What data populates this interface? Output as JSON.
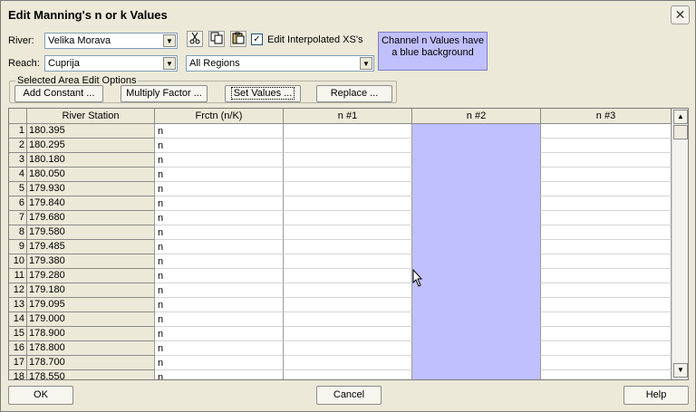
{
  "window": {
    "title": "Edit Manning's n or k Values",
    "close_glyph": "✕"
  },
  "river": {
    "label": "River:",
    "value": "Velika Morava"
  },
  "reach": {
    "label": "Reach:",
    "value": "Cuprija"
  },
  "regions": {
    "value": "All Regions"
  },
  "toolbar": {
    "cut_icon": "scissors-icon",
    "copy_icon": "copy-icon",
    "paste_icon": "paste-icon"
  },
  "interp": {
    "checked": true,
    "check_glyph": "✓",
    "label": "Edit Interpolated XS's"
  },
  "note": {
    "text": "Channel n Values have a blue background",
    "color": "#c0c0ff"
  },
  "selected_area": {
    "legend": "Selected Area Edit Options",
    "add_constant": "Add Constant ...",
    "multiply_factor": "Multiply Factor ...",
    "set_values": "Set Values ...",
    "replace": "Replace ..."
  },
  "table": {
    "headers": [
      "River Station",
      "Frctn (n/K)",
      "n #1",
      "n #2",
      "n #3"
    ],
    "rows": [
      {
        "num": "1",
        "station": "180.395",
        "frctn": "n"
      },
      {
        "num": "2",
        "station": "180.295",
        "frctn": "n"
      },
      {
        "num": "3",
        "station": "180.180",
        "frctn": "n"
      },
      {
        "num": "4",
        "station": "180.050",
        "frctn": "n"
      },
      {
        "num": "5",
        "station": "179.930",
        "frctn": "n"
      },
      {
        "num": "6",
        "station": "179.840",
        "frctn": "n"
      },
      {
        "num": "7",
        "station": "179.680",
        "frctn": "n"
      },
      {
        "num": "8",
        "station": "179.580",
        "frctn": "n"
      },
      {
        "num": "9",
        "station": "179.485",
        "frctn": "n"
      },
      {
        "num": "10",
        "station": "179.380",
        "frctn": "n"
      },
      {
        "num": "11",
        "station": "179.280",
        "frctn": "n"
      },
      {
        "num": "12",
        "station": "179.180",
        "frctn": "n"
      },
      {
        "num": "13",
        "station": "179.095",
        "frctn": "n"
      },
      {
        "num": "14",
        "station": "179.000",
        "frctn": "n"
      },
      {
        "num": "15",
        "station": "178.900",
        "frctn": "n"
      },
      {
        "num": "16",
        "station": "178.800",
        "frctn": "n"
      },
      {
        "num": "17",
        "station": "178.700",
        "frctn": "n"
      },
      {
        "num": "18",
        "station": "178.550",
        "frctn": "n"
      }
    ]
  },
  "footer": {
    "ok": "OK",
    "cancel": "Cancel",
    "help": "Help"
  }
}
